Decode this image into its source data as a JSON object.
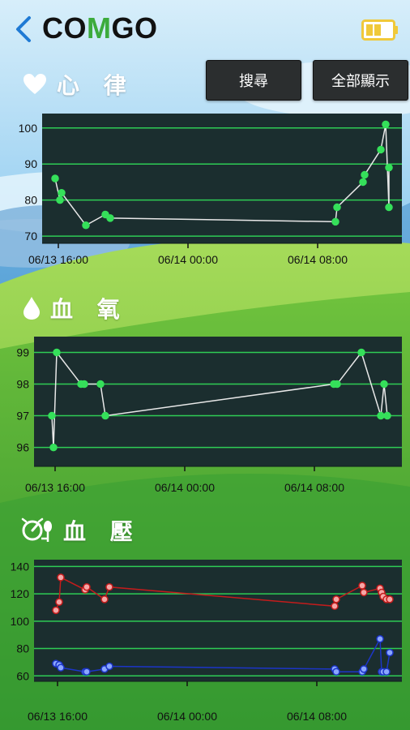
{
  "app": {
    "logo_prefix": "CO",
    "logo_m": "M",
    "logo_suffix": "GO"
  },
  "header": {
    "back_icon": "chevron-left-icon",
    "battery_icon": "battery-icon"
  },
  "buttons": {
    "search_label": "搜尋",
    "show_all_label": "全部顯示"
  },
  "sections": {
    "heart": {
      "title": "心 律",
      "icon": "heart-icon"
    },
    "spo2": {
      "title": "血 氧",
      "icon": "water-drop-icon"
    },
    "bp": {
      "title": "血 壓",
      "icon": "blood-pressure-gauge-icon"
    }
  },
  "colors": {
    "chart_bg": "#1b2e2f",
    "grid": "#2ecc55",
    "point_green": "#35e05a",
    "line_white": "#e8e8e8",
    "systolic": "#c41c1c",
    "diastolic": "#1c35c8"
  },
  "chart_data": [
    {
      "type": "line",
      "title": "",
      "xlabel": "",
      "ylabel": "",
      "x_ticks": [
        "06/13 16:00",
        "06/14 00:00",
        "06/14 08:00"
      ],
      "y_ticks": [
        70,
        80,
        90,
        100
      ],
      "ylim": [
        68,
        104
      ],
      "xlim_hours": [
        -0.1,
        20.1
      ],
      "series": [
        {
          "x_hours": [
            -0.2,
            0.1,
            0.2,
            1.7,
            2.9,
            3.2,
            17.1,
            17.2,
            18.8,
            18.9,
            19.9,
            20.2,
            20.4
          ],
          "values": [
            86,
            80,
            82,
            73,
            76,
            75,
            74,
            78,
            85,
            87,
            94,
            101,
            78,
            89
          ]
        }
      ]
    },
    {
      "type": "line",
      "title": "",
      "xlabel": "",
      "ylabel": "",
      "x_ticks": [
        "06/13 16:00",
        "06/14 00:00",
        "06/14 08:00"
      ],
      "y_ticks": [
        96,
        97,
        98,
        99
      ],
      "ylim": [
        95.4,
        99.5
      ],
      "series": [
        {
          "x_hours": [
            -0.2,
            -0.1,
            0.1,
            1.6,
            1.8,
            2.8,
            3.1,
            17.2,
            17.4,
            18.9,
            20.1,
            20.3,
            20.5
          ],
          "values": [
            97,
            96,
            99,
            98,
            98,
            98,
            97,
            98,
            98,
            99,
            97,
            98,
            97
          ]
        }
      ]
    },
    {
      "type": "line",
      "title": "",
      "xlabel": "",
      "ylabel": "",
      "x_ticks": [
        "06/13 16:00",
        "06/14 00:00",
        "06/14 08:00"
      ],
      "y_ticks": [
        60,
        80,
        100,
        120,
        140
      ],
      "ylim": [
        56,
        145
      ],
      "series": [
        {
          "x_hours": [
            -0.1,
            0.1,
            0.2,
            1.7,
            1.8,
            2.9,
            3.2,
            17.1,
            17.2,
            18.8,
            18.9,
            19.9,
            20.0,
            20.1,
            20.3,
            20.5
          ],
          "values": [
            108,
            114,
            132,
            123,
            125,
            116,
            125,
            111,
            116,
            126,
            121,
            124,
            121,
            118,
            116,
            116
          ]
        },
        {
          "x_hours": [
            -0.1,
            0.1,
            0.2,
            1.7,
            1.8,
            2.9,
            3.2,
            17.1,
            17.2,
            18.8,
            18.9,
            19.9,
            20.0,
            20.1,
            20.3,
            20.5
          ],
          "values": [
            69,
            68,
            66,
            63,
            63,
            65,
            67,
            65,
            63,
            63,
            65,
            87,
            63,
            63,
            63,
            77
          ]
        }
      ]
    }
  ]
}
